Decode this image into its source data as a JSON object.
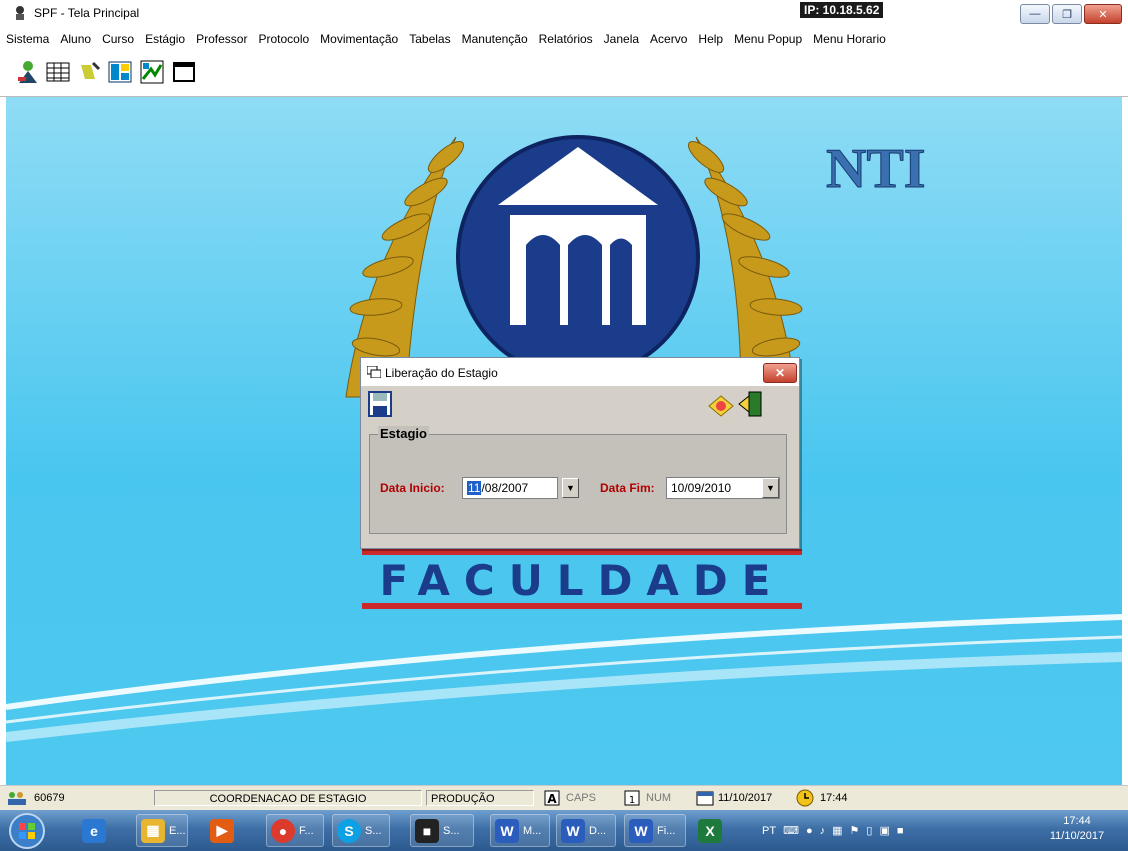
{
  "window": {
    "title": "SPF - Tela Principal",
    "ip": "IP: 10.18.5.62"
  },
  "menu": [
    "Sistema",
    "Aluno",
    "Curso",
    "Estágio",
    "Professor",
    "Protocolo",
    "Movimentação",
    "Tabelas",
    "Manutenção",
    "Relatórios",
    "Janela",
    "Acervo",
    "Help",
    "Menu Popup",
    "Menu Horario"
  ],
  "desktop": {
    "logo_text": "NTI",
    "brand": "FACULDADE"
  },
  "dialog": {
    "title": "Liberação do Estagio",
    "group": "Estagio",
    "start_label": "Data Inicio:",
    "start_day": "11",
    "start_rest": "/08/2007",
    "end_label": "Data Fim:",
    "end_value": "10/09/2010"
  },
  "status": {
    "user_code": "60679",
    "department": "COORDENACAO DE ESTAGIO",
    "env": "PRODUÇÃO",
    "caps": "CAPS",
    "num": "NUM",
    "date": "11/10/2017",
    "time": "17:44"
  },
  "taskbar": {
    "items": [
      "E...",
      "F...",
      "S...",
      "S...",
      "M...",
      "D...",
      "Fi..."
    ],
    "lang": "PT",
    "clock_time": "17:44",
    "clock_date": "11/10/2017"
  },
  "colors": {
    "desktop": "#49c6ef",
    "accent_red": "#b00000",
    "navy": "#1b3c8a"
  }
}
